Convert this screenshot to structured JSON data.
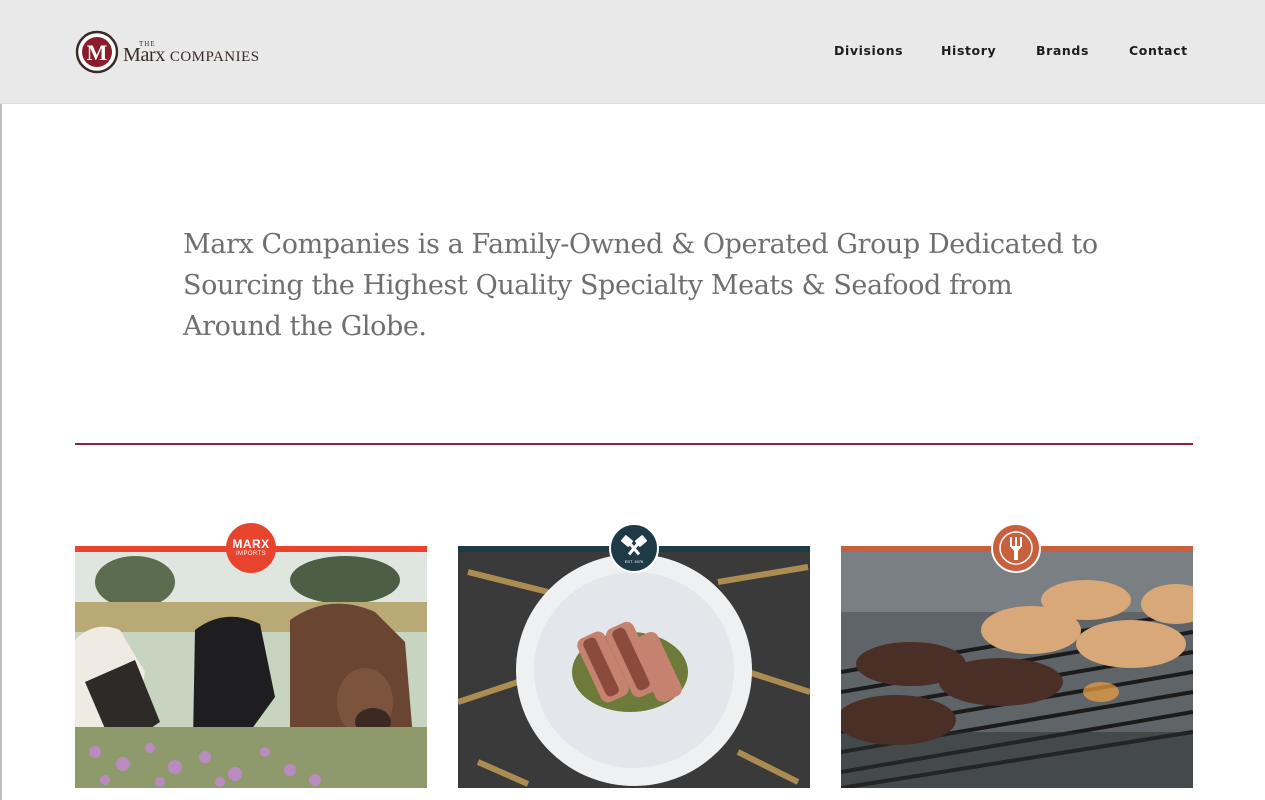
{
  "brand": {
    "the": "THE",
    "name_first": "Marx",
    "name_second": "Companies",
    "monogram": "M"
  },
  "nav": {
    "items": [
      {
        "label": "Divisions"
      },
      {
        "label": "History"
      },
      {
        "label": "Brands"
      },
      {
        "label": "Contact"
      }
    ]
  },
  "intro": {
    "text": "Marx Companies is a Family-Owned & Operated Group Dedicated to Sourcing the Highest Quality Specialty Meats & Seafood from Around the Globe."
  },
  "divisions": [
    {
      "badge_line1": "MARX",
      "badge_line2": "IMPORTS",
      "accent": "#e8432d",
      "icon": "marx-imports-logo",
      "photo": "cattle-in-field"
    },
    {
      "badge_text": "EST. 1976",
      "accent": "#1f3a47",
      "icon": "crossed-cleavers-icon",
      "photo": "sliced-meat-on-plate"
    },
    {
      "accent": "#c9603d",
      "icon": "fork-icon",
      "photo": "burgers-on-grill"
    }
  ],
  "colors": {
    "header_bg": "#e9e9e9",
    "divider": "#8f2233",
    "text": "#6f6f6f"
  }
}
